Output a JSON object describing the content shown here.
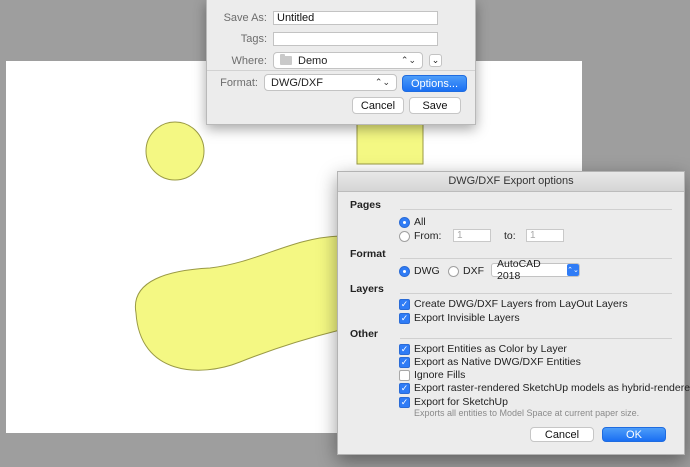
{
  "save_dialog": {
    "save_as_label": "Save As:",
    "save_as_value": "Untitled",
    "tags_label": "Tags:",
    "tags_value": "",
    "where_label": "Where:",
    "where_value": "Demo",
    "format_label": "Format:",
    "format_value": "DWG/DXF",
    "options_button": "Options...",
    "cancel_button": "Cancel",
    "save_button": "Save",
    "popup_arrows": "⌃⌄",
    "expand_glyph": "⌄"
  },
  "export_dialog": {
    "title": "DWG/DXF Export options",
    "pages": {
      "heading": "Pages",
      "all_label": "All",
      "all_selected": true,
      "from_label": "From:",
      "from_value": "1",
      "to_label": "to:",
      "to_value": "1"
    },
    "format": {
      "heading": "Format",
      "dwg_label": "DWG",
      "dwg_selected": true,
      "dxf_label": "DXF",
      "version_value": "AutoCAD 2018",
      "version_arrows": "⌃⌄"
    },
    "layers": {
      "heading": "Layers",
      "create_layers_label": "Create DWG/DXF Layers from LayOut Layers",
      "create_layers_checked": true,
      "export_invisible_label": "Export Invisible Layers",
      "export_invisible_checked": true
    },
    "other": {
      "heading": "Other",
      "color_by_layer_label": "Export Entities as Color by Layer",
      "color_by_layer_checked": true,
      "native_entities_label": "Export as Native DWG/DXF Entities",
      "native_entities_checked": true,
      "ignore_fills_label": "Ignore Fills",
      "ignore_fills_checked": false,
      "hybrid_label": "Export raster-rendered SketchUp models as hybrid-rendered",
      "hybrid_checked": true,
      "for_sketchup_label": "Export for SketchUp",
      "for_sketchup_checked": true,
      "for_sketchup_note": "Exports all entities to Model Space at current paper size."
    },
    "cancel_button": "Cancel",
    "ok_button": "OK",
    "check_glyph": "✓"
  },
  "colors": {
    "shape_fill": "#f4f883",
    "shape_stroke": "#9a9a45",
    "accent": "#2f7cf6"
  }
}
